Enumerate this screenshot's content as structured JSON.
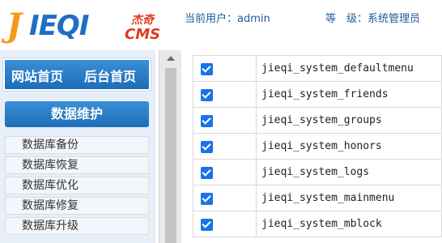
{
  "header": {
    "logo": {
      "mark": "J",
      "brand": "IEQI",
      "cn": "杰奇",
      "cms": "CMS"
    },
    "current_user_label": "当前用户：admin",
    "level_label": "等　级：系统管理员"
  },
  "sidebar": {
    "nav": {
      "site_home": "网站首页",
      "admin_home": "后台首页"
    },
    "section_title": "数据维护",
    "items": [
      {
        "label": "数据库备份"
      },
      {
        "label": "数据库恢复"
      },
      {
        "label": "数据库优化"
      },
      {
        "label": "数据库修复"
      },
      {
        "label": "数据库升级"
      }
    ]
  },
  "tables": {
    "rows": [
      {
        "name": "jieqi_system_defaultmenu",
        "checked": true
      },
      {
        "name": "jieqi_system_friends",
        "checked": true
      },
      {
        "name": "jieqi_system_groups",
        "checked": true
      },
      {
        "name": "jieqi_system_honors",
        "checked": true
      },
      {
        "name": "jieqi_system_logs",
        "checked": true
      },
      {
        "name": "jieqi_system_mainmenu",
        "checked": true
      },
      {
        "name": "jieqi_system_mblock",
        "checked": true
      }
    ]
  },
  "colors": {
    "accent": "#1d6db8",
    "logo_orange": "#f39a1a",
    "logo_blue": "#1f6fc4",
    "logo_red": "#e23b1e",
    "checkbox": "#1a73e8"
  }
}
